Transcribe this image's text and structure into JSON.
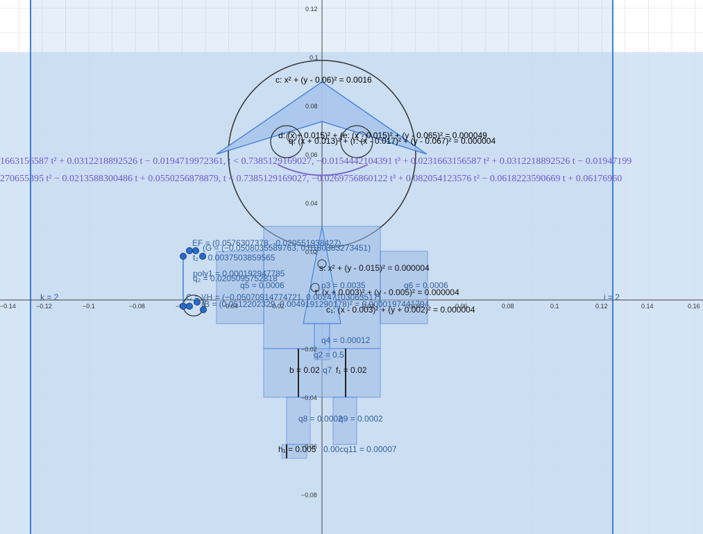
{
  "axes": {
    "x_ticks": [
      "−0.14",
      "−0.12",
      "−0.1",
      "−0.08",
      "−0.06",
      "−0.04",
      "−0.02",
      "0.02",
      "0.04",
      "0.06",
      "0.08",
      "0.1",
      "0.12",
      "0.14",
      "0.16"
    ],
    "y_ticks": [
      "0.12",
      "0.1",
      "0.08",
      "0.06",
      "0.04",
      "0.02",
      "−0.02",
      "−0.04",
      "−0.06",
      "−0.08"
    ]
  },
  "labels": {
    "c": "c: x² + (y - 0.06)² = 0.0016",
    "d": "d: (x + 0.015)² + (e: (x - 0.015)² + (y - 0.065)² = 0.000049",
    "q": "q: (x + 0.013)² + (r: (x - 0.017)² + (y - 0.067)² = 0.000004",
    "curve1": "1663156587 t² + 0.0312218892526 t − 0.0194719972361, t < 0.7385129169027, −0.0154442104391 t³ + 0.0231663156587 t² + 0.0312218892526 t − 0.01947199",
    "curve2": "270655395 t² − 0.0213588300486 t + 0.0550256878879, t < 0.7385129169027, −0.0269756860122 t³ + 0.082054123576 t² − 0.0618223590669 t + 0.06176960",
    "EF": "EF = (0.0576307378, -0.020551938427)",
    "G": "(G = (−0.0508035589763, 0.0180383273451)",
    "t2": "t₂ = 0.0037503859565",
    "poly1": "poly1 = 0.000192947785",
    "g2": "q₂ = 0.0205095752818",
    "q5": "q5 = 0.0006",
    "s": "s: x² + (y - 0.015)² = 0.000004",
    "p": "p3 = 0.0035",
    "q6": "q6 = 0.0006",
    "t": "t: (x + 0.003)² + (y - 0.005)² = 0.000004",
    "H": "C = \\(H = (−0.05070914774721, 0.00247103063517)",
    "Bpt": "(B = (0.0512202329, 0.0049191290178)² = 0.0000197441794",
    "c1": "c₁: (x - 0.003)² + (y + 0.002)² = 0.000004",
    "k": "k = 2",
    "i": "i = 2",
    "q4": "q4 = 0.00012",
    "q2b": "q2 = 0.5",
    "b": "b = 0.02",
    "q7": "q7",
    "f1": "f₁ = 0.02",
    "q8": "q8 = 0.0002",
    "q9": "q9 = 0.0002",
    "h1": "h₁ = 0.005",
    "q10": "0.00cq11 = 0.00007"
  },
  "colors": {
    "band": "#c9daf0",
    "shape_fill": "#9fbde6",
    "blue_line": "#3b7dd8",
    "grid": "#d9d9d9",
    "curve_text": "#6a5acd"
  }
}
